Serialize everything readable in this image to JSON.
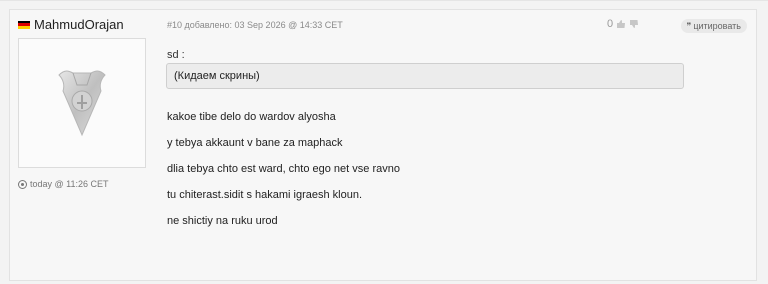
{
  "post": {
    "username": "MahmudOrajan",
    "author_local_time": "today @ 11:26 CET",
    "meta": "#10 добавлено: 03 Sep 2026 @ 14:33 CET",
    "rating": {
      "score": "0"
    },
    "quote_button_label": "цитировать",
    "quote": {
      "author": "sd :",
      "text": "(Кидаем скрины)"
    },
    "body_lines": [
      "kakoe tibe delo do wardov alyosha",
      "y tebya akkaunt v bane za maphack",
      "dlia tebya chto est ward, chto ego net vse ravno",
      "tu chiterast.sidit s hakami igraesh kloun.",
      "ne shictiy na ruku urod"
    ]
  },
  "colors": {
    "flag_black": "#000000",
    "flag_red": "#DD0000",
    "flag_gold": "#FFCE00",
    "panel_bg": "#f7f7f7",
    "quote_bg": "#ececec"
  },
  "icons": {
    "flag": "germany-flag-icon",
    "avatar": "silver-medallion-avatar",
    "clock": "clock-icon",
    "like": "thumbs-up-icon",
    "dislike": "thumbs-down-icon",
    "quote": "quote-icon"
  }
}
